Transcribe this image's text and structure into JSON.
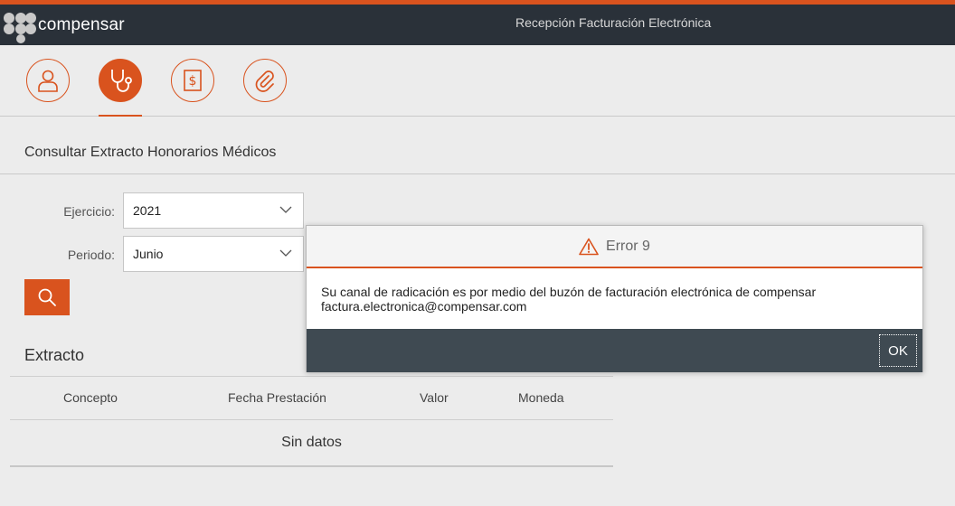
{
  "header": {
    "brand": "compensar",
    "title": "Recepción Facturación Electrónica"
  },
  "toolbar": {
    "tabs": [
      {
        "icon": "user-icon",
        "active": false
      },
      {
        "icon": "stethoscope-icon",
        "active": true
      },
      {
        "icon": "invoice-dollar-icon",
        "active": false
      },
      {
        "icon": "paperclip-icon",
        "active": false
      }
    ]
  },
  "section": {
    "title": "Consultar Extracto Honorarios Médicos"
  },
  "form": {
    "ejercicio_label": "Ejercicio:",
    "ejercicio_value": "2021",
    "periodo_label": "Periodo:",
    "periodo_value": "Junio"
  },
  "extracto": {
    "title": "Extracto",
    "columns": [
      "Concepto",
      "Fecha Prestación",
      "Valor",
      "Moneda"
    ],
    "empty_text": "Sin datos"
  },
  "dialog": {
    "title": "Error 9",
    "message_line1": "Su canal de radicación es por medio del buzón de facturación electrónica de compensar",
    "message_line2": "factura.electronica@compensar.com",
    "ok_label": "OK"
  },
  "colors": {
    "accent": "#d9531e",
    "header_bg": "#2a3139",
    "dialog_footer": "#3f4a52",
    "page_bg": "#ececec"
  }
}
